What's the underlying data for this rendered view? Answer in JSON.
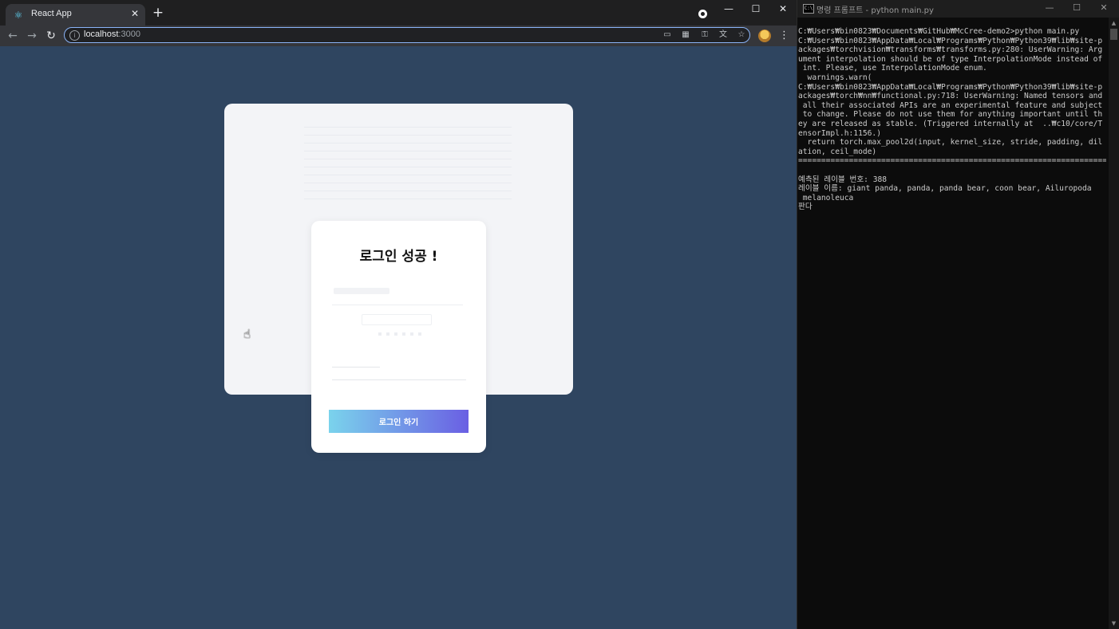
{
  "browser": {
    "tab_title": "React App",
    "tab_close": "✕",
    "new_tab": "+",
    "window_minimize": "—",
    "window_maximize": "☐",
    "window_close": "✕",
    "url_host": "localhost",
    "url_port": ":3000",
    "icons": [
      "react-favicon",
      "back-arrow",
      "forward-arrow",
      "reload",
      "info",
      "cast",
      "qr-code",
      "key",
      "translate",
      "star-bookmark",
      "profile-avatar",
      "menu-dots"
    ]
  },
  "page": {
    "background_color": "#2f4560",
    "login_title": "로그인 성공 !",
    "login_button_label": "로그인 하기",
    "button_gradient": [
      "#7ad3ec",
      "#6a5fe3"
    ]
  },
  "console": {
    "title": "명령 프롬프트 - python  main.py",
    "minimize": "—",
    "maximize": "☐",
    "close": "✕",
    "lines": [
      "C:₩Users₩bin0823₩Documents₩GitHub₩McCree-demo2>python main.py",
      "C:₩Users₩bin0823₩AppData₩Local₩Programs₩Python₩Python39₩lib₩site-p",
      "ackages₩torchvision₩transforms₩transforms.py:280: UserWarning: Arg",
      "ument interpolation should be of type InterpolationMode instead of",
      " int. Please, use InterpolationMode enum.",
      "  warnings.warn(",
      "C:₩Users₩bin0823₩AppData₩Local₩Programs₩Python₩Python39₩lib₩site-p",
      "ackages₩torch₩nn₩functional.py:718: UserWarning: Named tensors and",
      " all their associated APIs are an experimental feature and subject",
      " to change. Please do not use them for anything important until th",
      "ey are released as stable. (Triggered internally at  ..₩c10/core/T",
      "ensorImpl.h:1156.)",
      "  return torch.max_pool2d(input, kernel_size, stride, padding, dil",
      "ation, ceil_mode)",
      "===================================================================",
      "",
      "예측된 레이블 번호: 388",
      "레이블 이름: giant panda, panda, panda bear, coon bear, Ailuropoda",
      " melanoleuca",
      "판다"
    ]
  }
}
